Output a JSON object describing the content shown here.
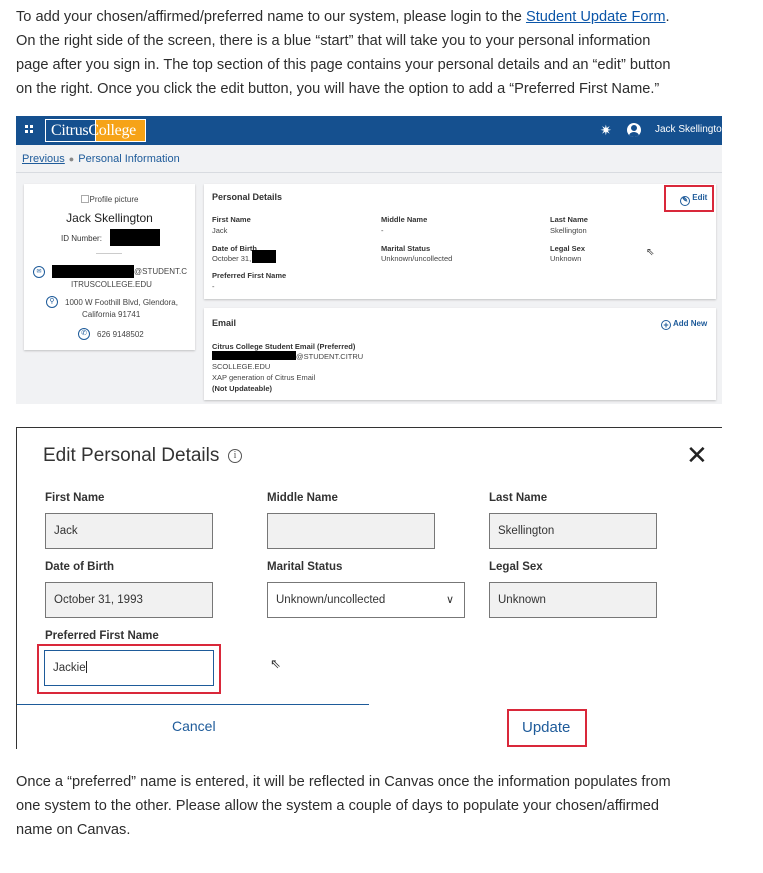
{
  "intro": {
    "text_before_link": "To add your chosen/affirmed/preferred name to our system, please login to the ",
    "link": "Student Update Form",
    "line2": "On the right side of the screen, there is a blue “start” that will take you to your personal information",
    "line3": "page after you sign in. The top section of this page contains your personal details and an “edit” button",
    "line4": "on the right.  Once you click the edit button, you will have the option to add a “Preferred First Name.”"
  },
  "shot1": {
    "logo": "CitrusCollege",
    "user_name": "Jack Skellington",
    "breadcrumb": {
      "previous": "Previous",
      "current": "Personal Information"
    },
    "profile": {
      "picture_alt": "Profile picture",
      "name": "Jack Skellington",
      "id_label": "ID Number:",
      "email_a": "@STUDENT.C",
      "email_b": "ITRUSCOLLEGE.EDU",
      "address_a": "1000 W Foothill Blvd, Glendora,",
      "address_b": "California 91741",
      "phone": "626 9148502"
    },
    "personal": {
      "title": "Personal Details",
      "edit": "Edit",
      "first_name_label": "First Name",
      "first_name": "Jack",
      "middle_name_label": "Middle Name",
      "middle_name": "-",
      "last_name_label": "Last Name",
      "last_name": "Skellington",
      "dob_label": "Date of Birth",
      "dob": "October 31,",
      "marital_label": "Marital Status",
      "marital": "Unknown/uncollected",
      "sex_label": "Legal Sex",
      "sex": "Unknown",
      "preferred_label": "Preferred First Name",
      "preferred": "-"
    },
    "email": {
      "title": "Email",
      "add_new": "Add New",
      "type": "Citrus College Student Email (Preferred)",
      "addr_a": "@STUDENT.CITRU",
      "addr_b": "SCOLLEGE.EDU",
      "note": "XAP generation of Citrus Email",
      "not_updateable": "(Not Updateable)"
    }
  },
  "shot2": {
    "title": "Edit Personal Details",
    "close": "✕",
    "first_name_label": "First Name",
    "first_name": "Jack",
    "middle_name_label": "Middle Name",
    "middle_name": "",
    "last_name_label": "Last Name",
    "last_name": "Skellington",
    "dob_label": "Date of Birth",
    "dob": "October 31, 1993",
    "marital_label": "Marital Status",
    "marital": "Unknown/uncollected",
    "sex_label": "Legal Sex",
    "sex": "Unknown",
    "preferred_label": "Preferred First Name",
    "preferred": "Jackie",
    "cancel": "Cancel",
    "update": "Update"
  },
  "outro": {
    "line1": "Once a “preferred” name is entered, it will be reflected in Canvas once the information populates from",
    "line2": "one system to the other.  Please allow the system a couple of days to populate your chosen/affirmed",
    "line3": "name on Canvas."
  },
  "colors": {
    "topbar": "#15508f",
    "logo_accent": "#f6a317",
    "highlight_red": "#d9283a",
    "link_blue": "#1e5b9a"
  }
}
